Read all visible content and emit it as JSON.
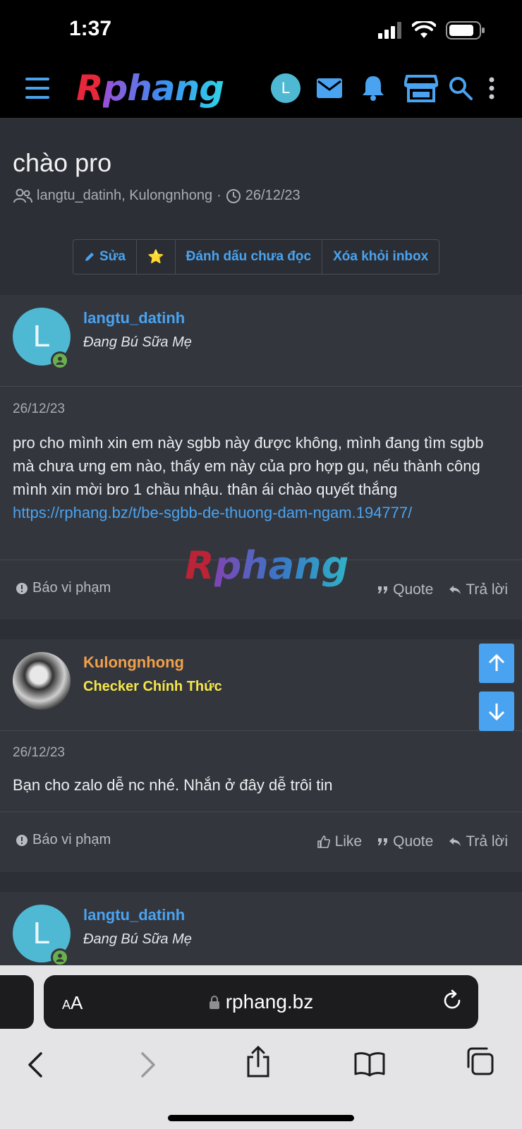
{
  "status_bar": {
    "time": "1:37"
  },
  "header": {
    "logo": {
      "r": "R",
      "rest": "phang"
    },
    "avatar_letter": "L"
  },
  "thread": {
    "title": "chào pro",
    "participants": "langtu_datinh, Kulongnhong",
    "separator": "·",
    "date": "26/12/23",
    "buttons": {
      "edit": "Sửa",
      "star": "⭐",
      "mark_unread": "Đánh dấu chưa đọc",
      "remove_inbox": "Xóa khỏi inbox"
    }
  },
  "messages": [
    {
      "author": "langtu_datinh",
      "author_color": "#4aa3f0",
      "user_title": "Đang Bú Sữa Mẹ",
      "avatar_letter": "L",
      "date": "26/12/23",
      "text": "pro cho mình xin em này sgbb này được không, mình đang tìm sgbb mà chưa ưng em nào, thấy em này của pro hợp gu, nếu thành công mình xin mời bro 1 chầu nhậu. thân ái chào quyết thắng",
      "link": "https://rphang.bz/t/be-sgbb-de-thuong-dam-ngam.194777/",
      "report": "Báo vi phạm",
      "quote": "Quote",
      "reply": "Trả lời"
    },
    {
      "author": "Kulongnhong",
      "author_color": "#f0a04b",
      "user_title": "Checker Chính Thức",
      "user_title_color": "#f5e64a",
      "date": "26/12/23",
      "text": "Bạn cho zalo dễ nc nhé. Nhắn ở đây dễ trôi tin",
      "report": "Báo vi phạm",
      "like": "Like",
      "quote": "Quote",
      "reply": "Trả lời"
    },
    {
      "author": "langtu_datinh",
      "user_title": "Đang Bú Sữa Mẹ",
      "avatar_letter": "L"
    }
  ],
  "watermark": {
    "r": "R",
    "rest": "phang"
  },
  "browser": {
    "aa_small": "A",
    "aa_large": "A",
    "url": "rphang.bz"
  },
  "icons": [
    "hamburger-icon",
    "mail-icon",
    "bell-icon",
    "store-icon",
    "search-icon",
    "more-vertical-icon",
    "users-icon",
    "clock-icon",
    "pencil-icon",
    "alert-icon",
    "quote-icon",
    "reply-icon",
    "like-icon",
    "arrow-up-icon",
    "arrow-down-icon",
    "lock-icon",
    "reload-icon",
    "back-icon",
    "forward-icon",
    "share-icon",
    "bookmarks-icon",
    "tabs-icon"
  ]
}
